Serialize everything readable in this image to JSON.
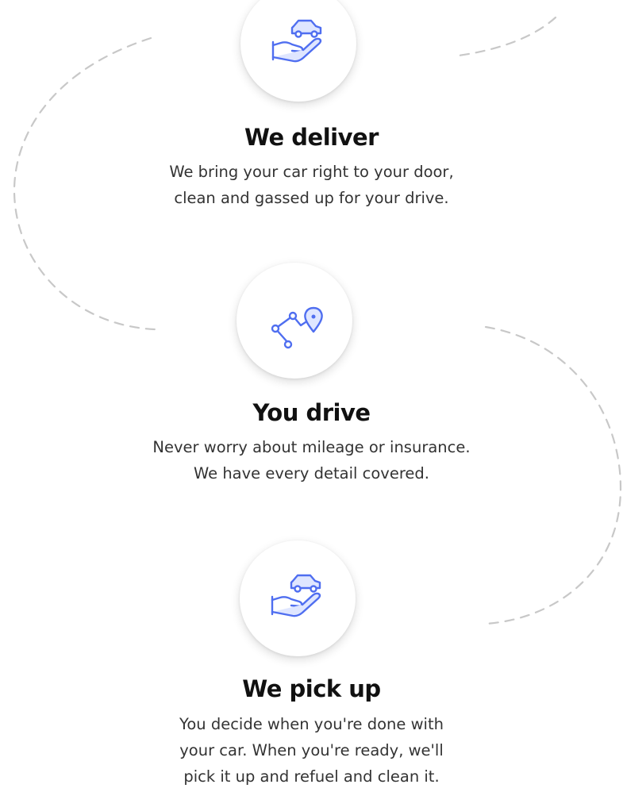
{
  "colors": {
    "icon_stroke": "#4f6ef0",
    "icon_fill_light": "#dfe6ff",
    "path_dash": "#c8c8c8",
    "title": "#111111",
    "text": "#333333"
  },
  "steps": [
    {
      "icon": "car-delivery-hand-icon",
      "title": "We deliver",
      "description_lines": [
        "We bring your car right to your door,",
        "clean and gassed up for your drive."
      ]
    },
    {
      "icon": "route-map-pin-icon",
      "title": "You drive",
      "description_lines": [
        "Never worry about mileage or insurance.",
        "We have every detail covered."
      ]
    },
    {
      "icon": "car-pickup-hand-icon",
      "title": "We pick up",
      "description_lines": [
        "You decide when you're done with",
        "your car. When you're ready, we'll",
        "pick it up and refuel and clean it."
      ]
    }
  ]
}
